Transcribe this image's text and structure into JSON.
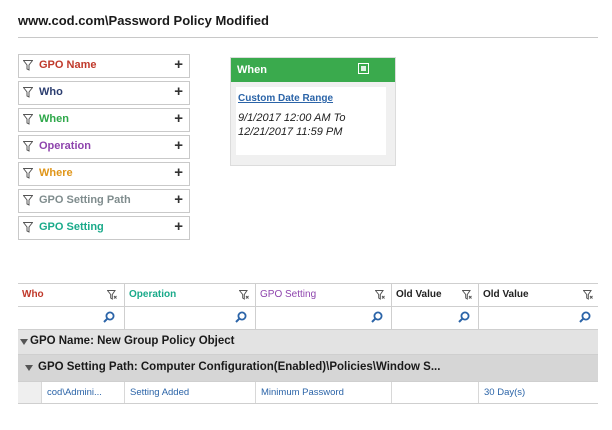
{
  "title": "www.cod.com\\Password Policy Modified",
  "colors": {
    "gpo_name": "#c0392b",
    "who": "#2c3e70",
    "when": "#2ea84a",
    "operation": "#8e44ad",
    "where": "#e0961a",
    "gpo_setting_path": "#7f8c8d",
    "gpo_setting": "#1aaa8a",
    "panel_header": "#3aaa4d",
    "link": "#2b64a8"
  },
  "filters": [
    {
      "label": "GPO Name",
      "icon": "filter-icon",
      "add_icon": "plus-icon"
    },
    {
      "label": "Who",
      "icon": "filter-icon",
      "add_icon": "plus-icon"
    },
    {
      "label": "When",
      "icon": "filter-icon",
      "add_icon": "plus-icon"
    },
    {
      "label": "Operation",
      "icon": "filter-icon",
      "add_icon": "plus-icon"
    },
    {
      "label": "Where",
      "icon": "filter-icon",
      "add_icon": "plus-icon"
    },
    {
      "label": "GPO Setting Path",
      "icon": "filter-icon",
      "add_icon": "plus-icon"
    },
    {
      "label": "GPO Setting",
      "icon": "filter-icon",
      "add_icon": "plus-icon"
    }
  ],
  "when_panel": {
    "title": "When",
    "link": "Custom Date Range",
    "range_line1": "9/1/2017 12:00 AM To",
    "range_line2": "12/21/2017 11:59 PM"
  },
  "grid": {
    "columns": [
      "Who",
      "Operation",
      "GPO Setting",
      "Old Value",
      "Old Value"
    ],
    "group1": "GPO Name: New Group Policy Object",
    "group2": "GPO Setting Path: Computer Configuration(Enabled)\\Policies\\Window S...",
    "rows": [
      {
        "who": "cod\\Admini...",
        "operation": "Setting Added",
        "gpo_setting": "Minimum Password",
        "old_value_1": "",
        "old_value_2": "30 Day(s)"
      }
    ]
  }
}
